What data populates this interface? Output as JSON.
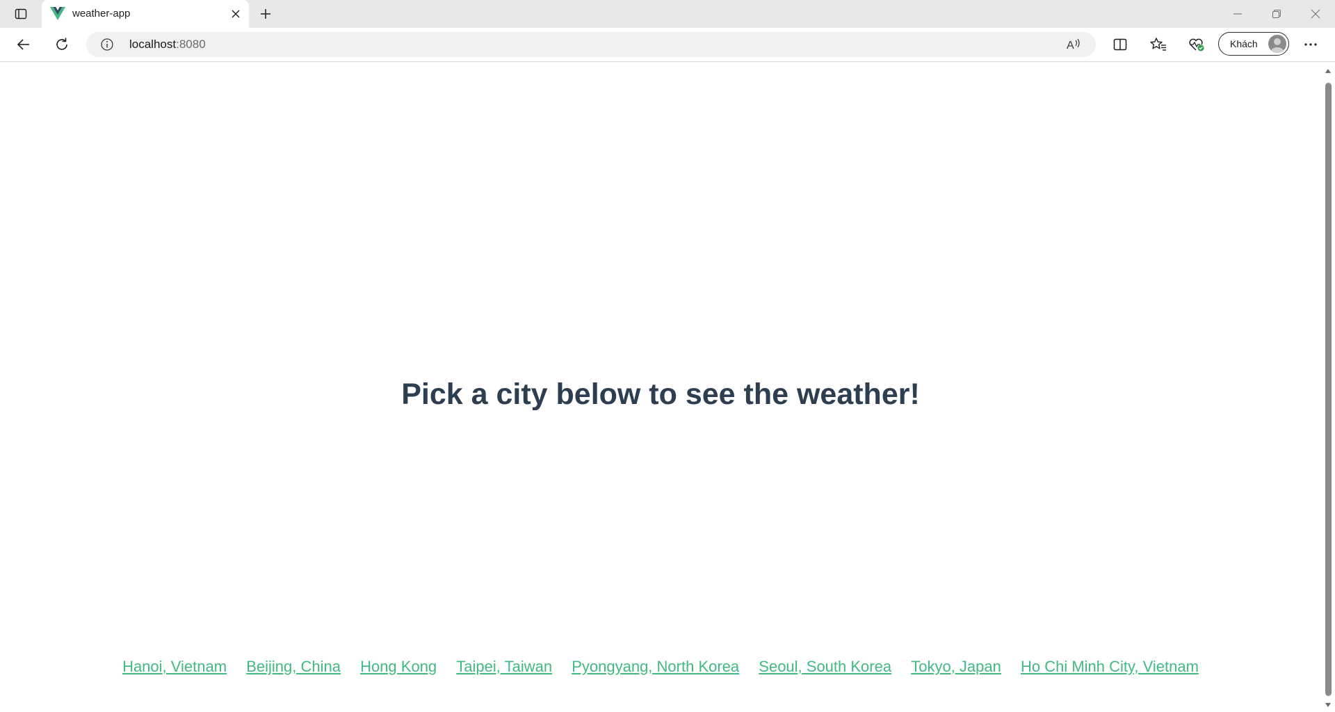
{
  "browser": {
    "tab": {
      "title": "weather-app",
      "favicon": "vue-logo-icon"
    },
    "address": {
      "host": "localhost",
      "port": ":8080"
    },
    "profile": {
      "label": "Khách"
    },
    "icons": {
      "tab_actions": "tab-actions-icon",
      "close_tab": "close-icon",
      "new_tab": "plus-icon",
      "minimize": "minimize-icon",
      "restore": "restore-icon",
      "close_window": "close-icon",
      "back": "back-arrow-icon",
      "refresh": "refresh-icon",
      "site_info": "info-icon",
      "read_aloud": "read-aloud-icon",
      "split_screen": "split-screen-icon",
      "favorites": "favorites-icon",
      "browser_essentials": "heart-pulse-icon",
      "more": "more-icon"
    },
    "colors": {
      "tabstrip": "#e8e8e8",
      "vue_green": "#42b983",
      "vue_dark": "#35495e"
    }
  },
  "page": {
    "heading": "Pick a city below to see the weather!",
    "heading_color": "#2c3e50",
    "link_color": "#42b983",
    "cities": [
      "Hanoi, Vietnam",
      "Beijing, China",
      "Hong Kong",
      "Taipei, Taiwan",
      "Pyongyang, North Korea",
      "Seoul, South Korea",
      "Tokyo, Japan",
      "Ho Chi Minh City, Vietnam"
    ]
  }
}
